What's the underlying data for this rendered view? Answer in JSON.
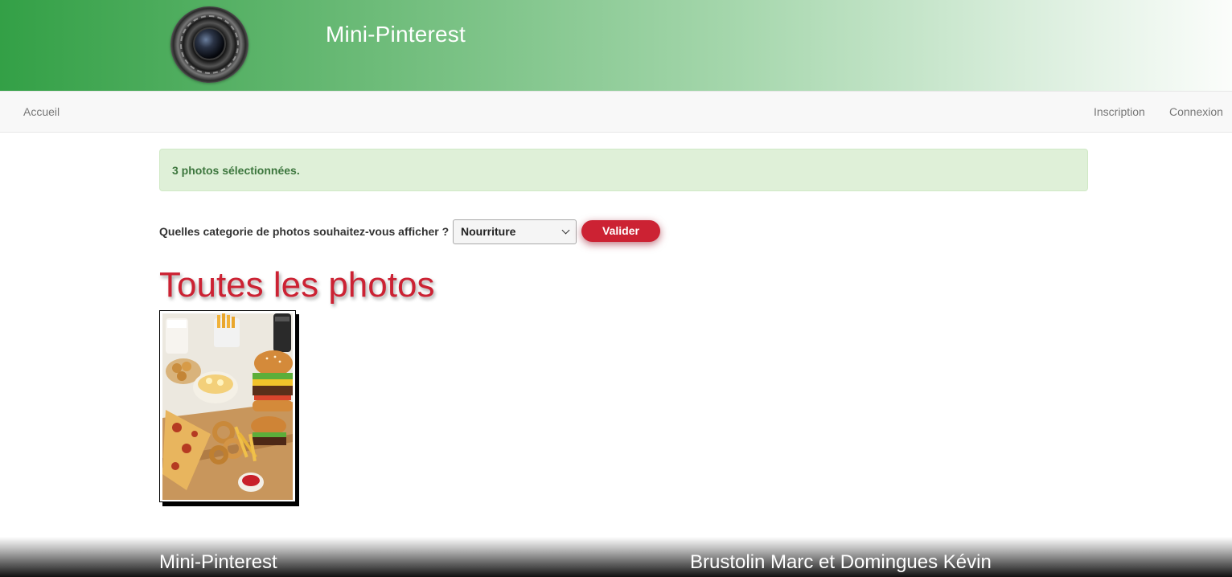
{
  "header": {
    "title": "Mini-Pinterest",
    "logo_icon": "camera-lens-icon"
  },
  "nav": {
    "home": "Accueil",
    "register": "Inscription",
    "login": "Connexion"
  },
  "alert": {
    "message": "3 photos sélectionnées."
  },
  "category_form": {
    "label": "Quelles categorie de photos souhaitez-vous afficher ?",
    "selected": "Nourriture",
    "submit_label": "Valider"
  },
  "gallery": {
    "title": "Toutes les photos",
    "photos": [
      {
        "subject": "fast-food-photo"
      }
    ]
  },
  "footer": {
    "left": "Mini-Pinterest",
    "right": "Brustolin Marc et Domingues Kévin"
  },
  "colors": {
    "accent_red": "#cc2233",
    "header_green": "#33a046",
    "alert_bg": "#dff0d8",
    "alert_text": "#3c763d"
  }
}
